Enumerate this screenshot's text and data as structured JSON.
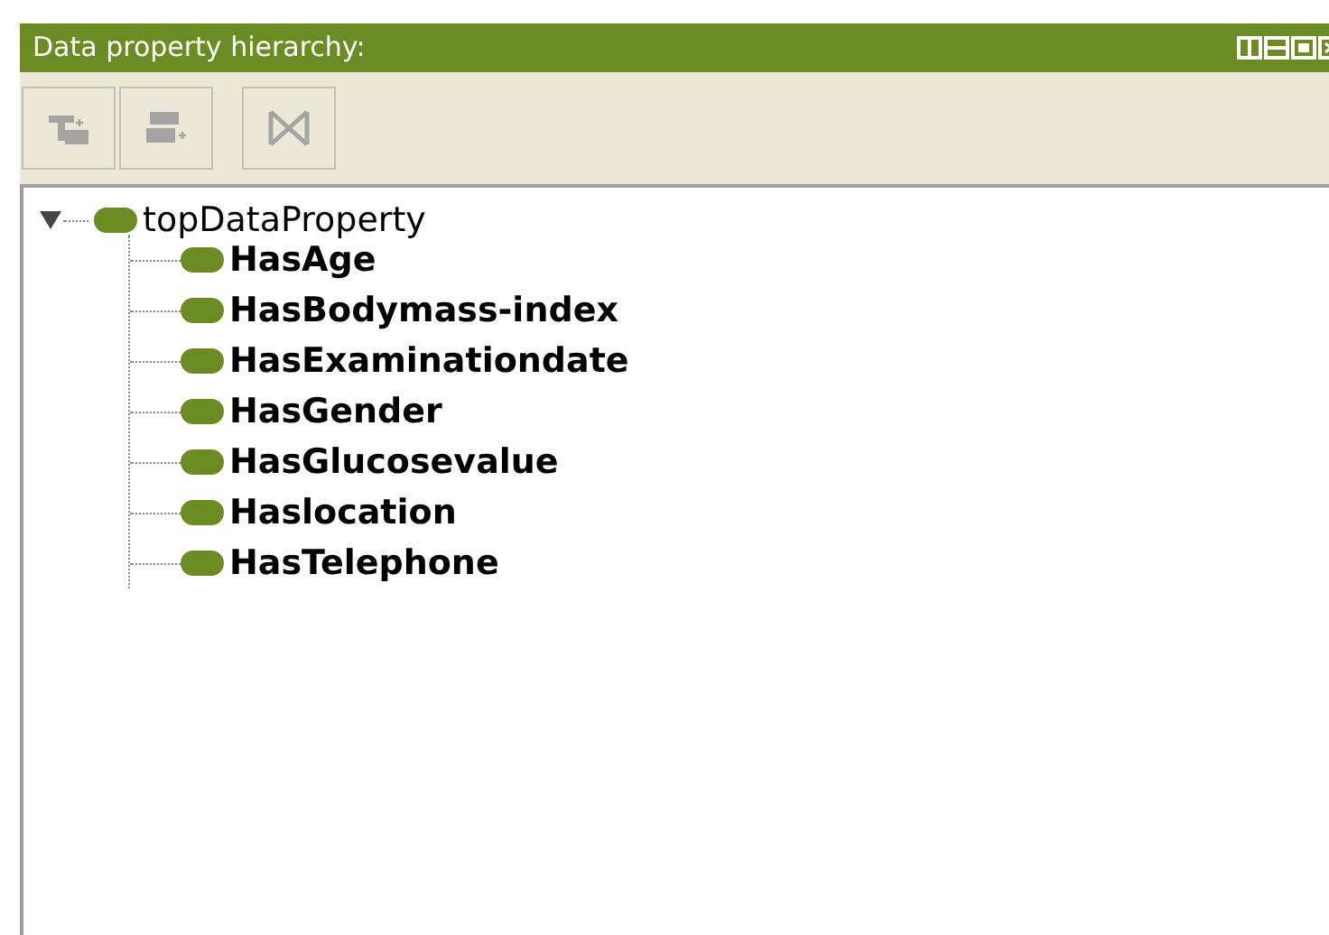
{
  "panel": {
    "title": "Data property hierarchy:"
  },
  "toolbar": [
    {
      "kind": "add-sub",
      "disabled": true
    },
    {
      "kind": "add-sibling",
      "disabled": true
    },
    {
      "kind": "delete",
      "disabled": true
    }
  ],
  "tree": [
    {
      "label": "topDataProperty",
      "expanded": true,
      "bold": false,
      "children": [
        {
          "label": "HasAge",
          "bold": true
        },
        {
          "label": "HasBodymass-index",
          "bold": true
        },
        {
          "label": "HasExaminationdate",
          "bold": true
        },
        {
          "label": "HasGender",
          "bold": true
        },
        {
          "label": "HasGlucosevalue",
          "bold": true
        },
        {
          "label": "Haslocation",
          "bold": true
        },
        {
          "label": "HasTelephone",
          "bold": true
        }
      ]
    }
  ]
}
